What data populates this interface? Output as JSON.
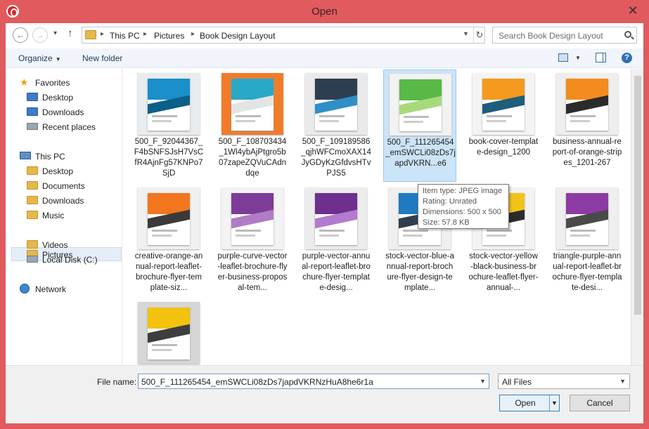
{
  "window": {
    "title": "Open"
  },
  "address": {
    "crumbs": [
      "This PC",
      "Pictures",
      "Book Design Layout"
    ]
  },
  "search": {
    "placeholder": "Search Book Design Layout"
  },
  "toolbar": {
    "organize": "Organize",
    "new_folder": "New folder"
  },
  "nav": {
    "favorites": "Favorites",
    "desktop": "Desktop",
    "downloads": "Downloads",
    "recent": "Recent places",
    "this_pc": "This PC",
    "pc_desktop": "Desktop",
    "documents": "Documents",
    "pc_downloads": "Downloads",
    "music": "Music",
    "pictures": "Pictures",
    "videos": "Videos",
    "local_disk": "Local Disk (C:)",
    "network": "Network"
  },
  "files": [
    {
      "name": "500_F_92044367_F4bSNFSJsH7VsCfR4AjnFg57KNPo7SjD",
      "selected": false
    },
    {
      "name": "500_F_108703434_1Wl4ybAjPtgro5b07zapeZQVuCAdndqe",
      "selected": false
    },
    {
      "name": "500_F_109189586_qjhWFCmoXAX14JyGDyKzGfdvsHTvPJS5",
      "selected": false
    },
    {
      "name": "500_F_111265454_emSWCLi08zDs7japdVKRN...e6",
      "selected": true
    },
    {
      "name": "book-cover-template-design_1200",
      "selected": false
    },
    {
      "name": "business-annual-report-of-orange-stripes_1201-267",
      "selected": false
    },
    {
      "name": "creative-orange-annual-report-leaflet-brochure-flyer-template-siz...",
      "selected": false
    },
    {
      "name": "purple-curve-vector-leaflet-brochure-flyer-business-proposal-tem...",
      "selected": false
    },
    {
      "name": "purple-vector-annual-report-leaflet-brochure-flyer-template-desig...",
      "selected": false
    },
    {
      "name": "stock-vector-blue-annual-report-brochure-flyer-design-template...",
      "selected": false
    },
    {
      "name": "stock-vector-yellow-black-business-brochure-leaflet-flyer-annual-...",
      "selected": false
    },
    {
      "name": "triangle-purple-annual-report-leaflet-brochure-flyer-template-desi...",
      "selected": false
    },
    {
      "name": "",
      "selected": false
    }
  ],
  "tooltip": {
    "type": "Item type: JPEG image",
    "rating": "Rating: Unrated",
    "dimensions": "Dimensions: 500 x 500",
    "size": "Size: 57.8 KB"
  },
  "footer": {
    "file_name_label": "File name:",
    "file_name_value": "500_F_111265454_emSWCLi08zDs7japdVKRNzHuA8he6r1a",
    "file_type": "All Files",
    "open": "Open",
    "cancel": "Cancel"
  },
  "colors": {
    "titlebar": "#e05a5e",
    "selection": "#cce4f7",
    "accent": "#3c7fb1"
  }
}
